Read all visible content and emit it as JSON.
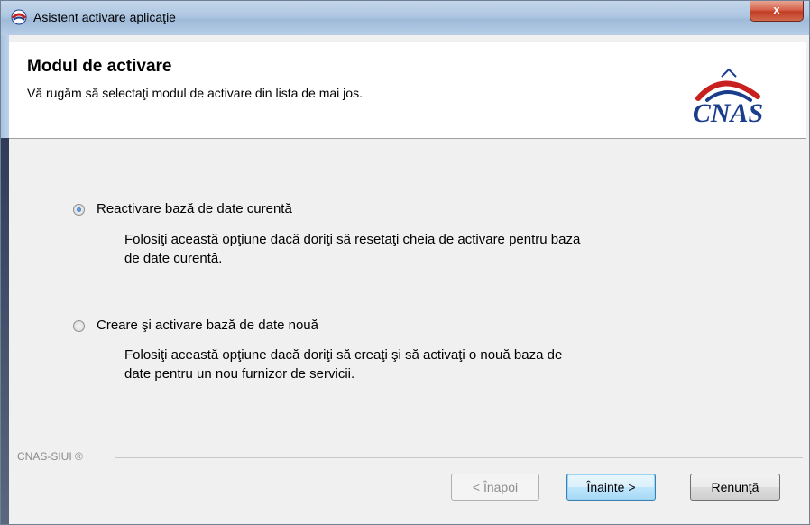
{
  "window": {
    "title": "Asistent activare aplicaţie",
    "close_label": "x"
  },
  "header": {
    "title": "Modul de activare",
    "subtitle": "Vă rugăm să selectaţi modul de activare din lista de mai jos.",
    "logo_text": "CNAS"
  },
  "options": [
    {
      "label": "Reactivare bază de date curentă",
      "description_line1": "Folosiţi această opţiune dacă doriţi să resetaţi cheia de activare pentru baza",
      "description_line2": "de date curentă.",
      "selected": true
    },
    {
      "label": "Creare şi activare bază de date nouă",
      "description_line1": "Folosiţi această opţiune dacă doriţi să creaţi şi să activaţi o nouă baza de",
      "description_line2": "date pentru un nou furnizor de servicii.",
      "selected": false
    }
  ],
  "footer": {
    "brand": "CNAS-SIUI ®"
  },
  "buttons": {
    "back": "< Înapoi",
    "next": "Înainte >",
    "cancel": "Renunţă"
  },
  "colors": {
    "logo_blue": "#1a3e8c",
    "logo_red": "#c8201e"
  }
}
